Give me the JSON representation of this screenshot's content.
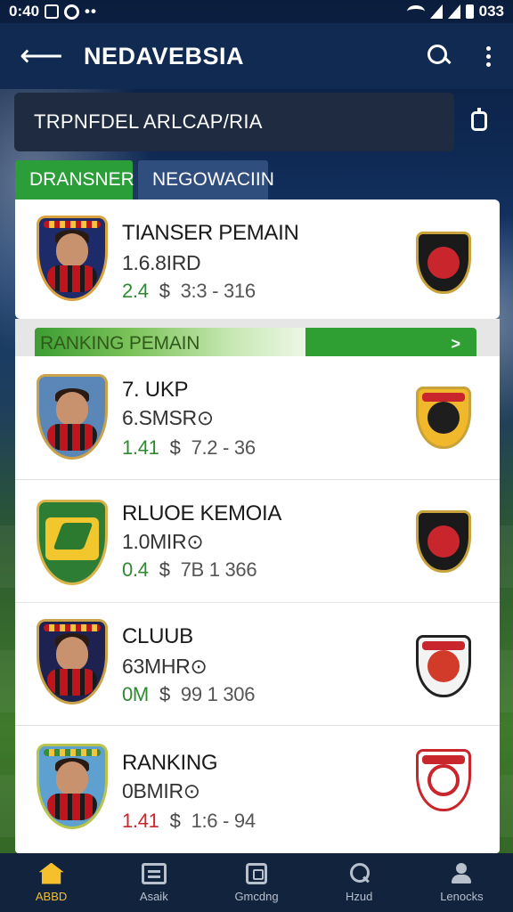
{
  "status_bar": {
    "time": "0:40",
    "battery": "033"
  },
  "app_bar": {
    "title": "NEDAVEBSIA"
  },
  "search": {
    "text": "TRPNFDEL ARLCAP/RIA"
  },
  "tabs": [
    {
      "label": "DRANSNER",
      "active": true
    },
    {
      "label": "NEGOWACIIN",
      "active": false
    }
  ],
  "featured": {
    "title": "TIANSER PEMAIN",
    "sub": "1.6.8IRD",
    "pct": "2.4",
    "currency": "$",
    "range": "3:3 - 316"
  },
  "banner": {
    "label": "RANKING PEMAIN",
    "go": ">"
  },
  "players": [
    {
      "title": "7. UKP",
      "sub": "6.SMSR⊙",
      "pct": "1.41",
      "pct_color": "green",
      "currency": "$",
      "range": "7.2 - 36"
    },
    {
      "title": "RLUOE KEMOIA",
      "sub": "1.0MIR⊙",
      "pct": "0.4",
      "pct_color": "green",
      "currency": "$",
      "range": "7B 1 366"
    },
    {
      "title": "CLUUB",
      "sub": "63MHR⊙",
      "pct": "0M",
      "pct_color": "green",
      "currency": "$",
      "range": "99 1 306"
    },
    {
      "title": "RANKING",
      "sub": "0BMIR⊙",
      "pct": "1.41",
      "pct_color": "red",
      "currency": "$",
      "range": "1:6 - 94"
    }
  ],
  "bottom_nav": [
    {
      "label": "ABBD",
      "icon": "home-icon",
      "active": true
    },
    {
      "label": "Asaik",
      "icon": "news-icon",
      "active": false
    },
    {
      "label": "Gmcdng",
      "icon": "calendar-icon",
      "active": false
    },
    {
      "label": "Hzud",
      "icon": "search-icon",
      "active": false
    },
    {
      "label": "Lenocks",
      "icon": "user-icon",
      "active": false
    }
  ],
  "colors": {
    "accent": "#2b9d39",
    "appbar": "#112a52",
    "nav_active": "#f5c02b"
  }
}
